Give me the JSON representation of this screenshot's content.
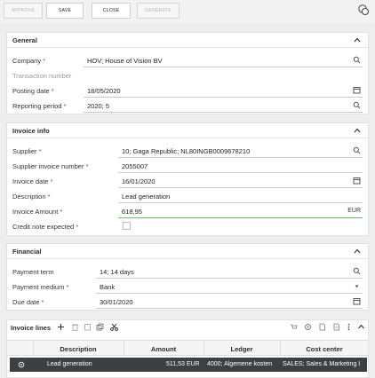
{
  "toolbar": {
    "approve_label": "APPROVE",
    "save_label": "SAVE",
    "close_label": "CLOSE",
    "generate_label": "GENERATE"
  },
  "general": {
    "title": "General",
    "company_label": "Company",
    "company_value": "HOV; House of Vision BV",
    "transaction_label": "Transaction number",
    "posting_label": "Posting date",
    "posting_value": "18/05/2020",
    "period_label": "Reporting period",
    "period_value": "2020; 5"
  },
  "invoice": {
    "title": "Invoice info",
    "supplier_label": "Supplier",
    "supplier_value": "10; Gaga Republic; NL80INGB0009678210",
    "supplier_invoice_label": "Supplier invoice number",
    "supplier_invoice_value": "2055007",
    "invoice_date_label": "Invoice date",
    "invoice_date_value": "16/01/2020",
    "description_label": "Description",
    "description_value": "Lead generation",
    "amount_label": "Invoice Amount",
    "amount_value": "618,95",
    "amount_currency": "EUR",
    "credit_label": "Credit note expected"
  },
  "financial": {
    "title": "Financial",
    "term_label": "Payment term",
    "term_value": "14; 14 days",
    "medium_label": "Payment medium",
    "medium_value": "Bank",
    "due_label": "Due date",
    "due_value": "30/01/2020"
  },
  "lines": {
    "title": "Invoice lines",
    "columns": [
      "Description",
      "Amount",
      "Ledger",
      "Cost center"
    ],
    "rows": [
      {
        "description": "Lead generation",
        "amount": "511,53 EUR",
        "ledger": "4000; Algemene kosten",
        "cost_center": "SALES; Sales & Marketing I"
      }
    ]
  },
  "colors": {
    "required": "#d9302b",
    "selected_row": "#3b4045",
    "active_input": "#6abf6a"
  }
}
